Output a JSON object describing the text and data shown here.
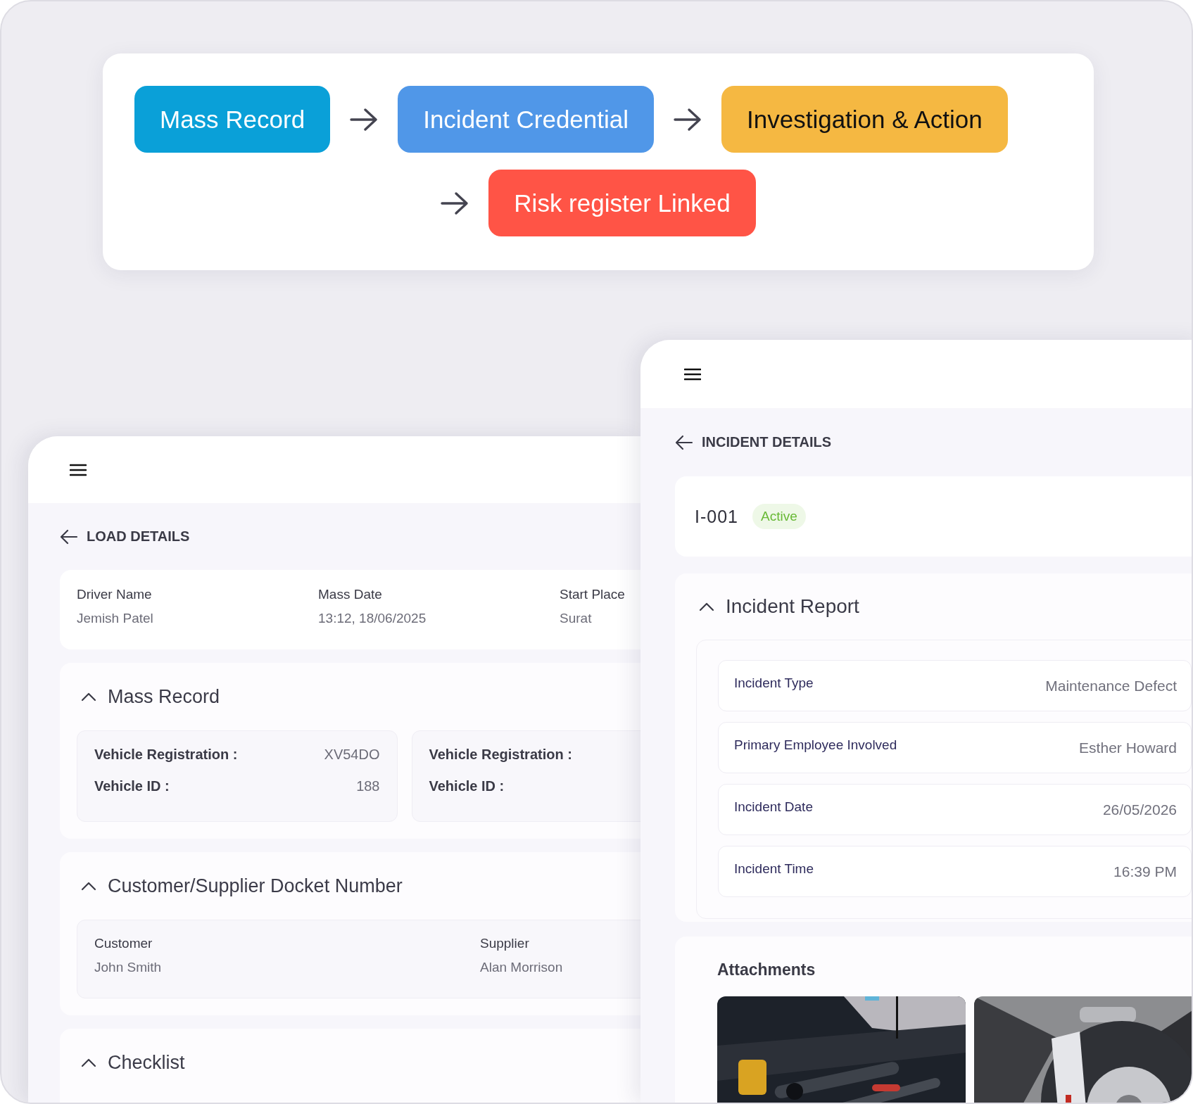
{
  "flow": {
    "steps": [
      {
        "label": "Mass Record",
        "color": "#0aa0d8"
      },
      {
        "label": "Incident Credential",
        "color": "#5097e8"
      },
      {
        "label": "Investigation & Action",
        "color": "#f5b842"
      },
      {
        "label": "Risk register Linked",
        "color": "#ff5446"
      }
    ]
  },
  "load_panel": {
    "title": "LOAD DETAILS",
    "summary": [
      {
        "label": "Driver Name",
        "value": "Jemish Patel"
      },
      {
        "label": "Mass Date",
        "value": "13:12, 18/06/2025"
      },
      {
        "label": "Start Place",
        "value": "Surat"
      }
    ],
    "sections": [
      {
        "kind": "vehicles",
        "title": "Mass Record",
        "expanded": true,
        "cards": [
          {
            "rows": [
              {
                "label": "Vehicle Registration :",
                "value": "XV54DO"
              },
              {
                "label": "Vehicle ID :",
                "value": "188"
              }
            ]
          },
          {
            "rows": [
              {
                "label": "Vehicle Registration :"
              },
              {
                "label": "Vehicle ID :"
              }
            ]
          }
        ]
      },
      {
        "kind": "fields",
        "title": "Customer/Supplier Docket Number",
        "expanded": true,
        "fields": [
          {
            "label": "Customer",
            "value": "John Smith"
          },
          {
            "label": "Supplier",
            "value": "Alan Morrison"
          }
        ]
      },
      {
        "kind": "empty",
        "title": "Checklist",
        "expanded": true
      }
    ]
  },
  "incident_panel": {
    "title": "INCIDENT DETAILS",
    "id": "I-001",
    "status": "Active",
    "report": {
      "title": "Incident Report",
      "expanded": true,
      "rows": [
        {
          "label": "Incident Type",
          "value": "Maintenance Defect"
        },
        {
          "label": "Primary Employee Involved",
          "value": "Esther Howard"
        },
        {
          "label": "Incident Date",
          "value": "26/05/2026"
        },
        {
          "label": "Incident Time",
          "value": "16:39 PM"
        }
      ]
    },
    "attachments": {
      "title": "Attachments"
    }
  }
}
